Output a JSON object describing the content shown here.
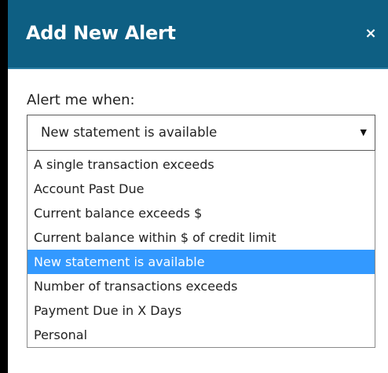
{
  "dialog": {
    "title": "Add New Alert",
    "close_label": "×"
  },
  "form": {
    "label": "Alert me when:",
    "selected_value": "New statement is available",
    "arrow": "▼",
    "options": [
      "A single transaction exceeds",
      "Account Past Due",
      "Current balance exceeds $",
      "Current balance within $ of credit limit",
      "New statement is available",
      "Number of transactions exceeds",
      "Payment Due in X Days",
      "Personal"
    ],
    "selected_index": 4
  },
  "colors": {
    "header_bg": "#0e5f83",
    "highlight": "#3399ff"
  }
}
